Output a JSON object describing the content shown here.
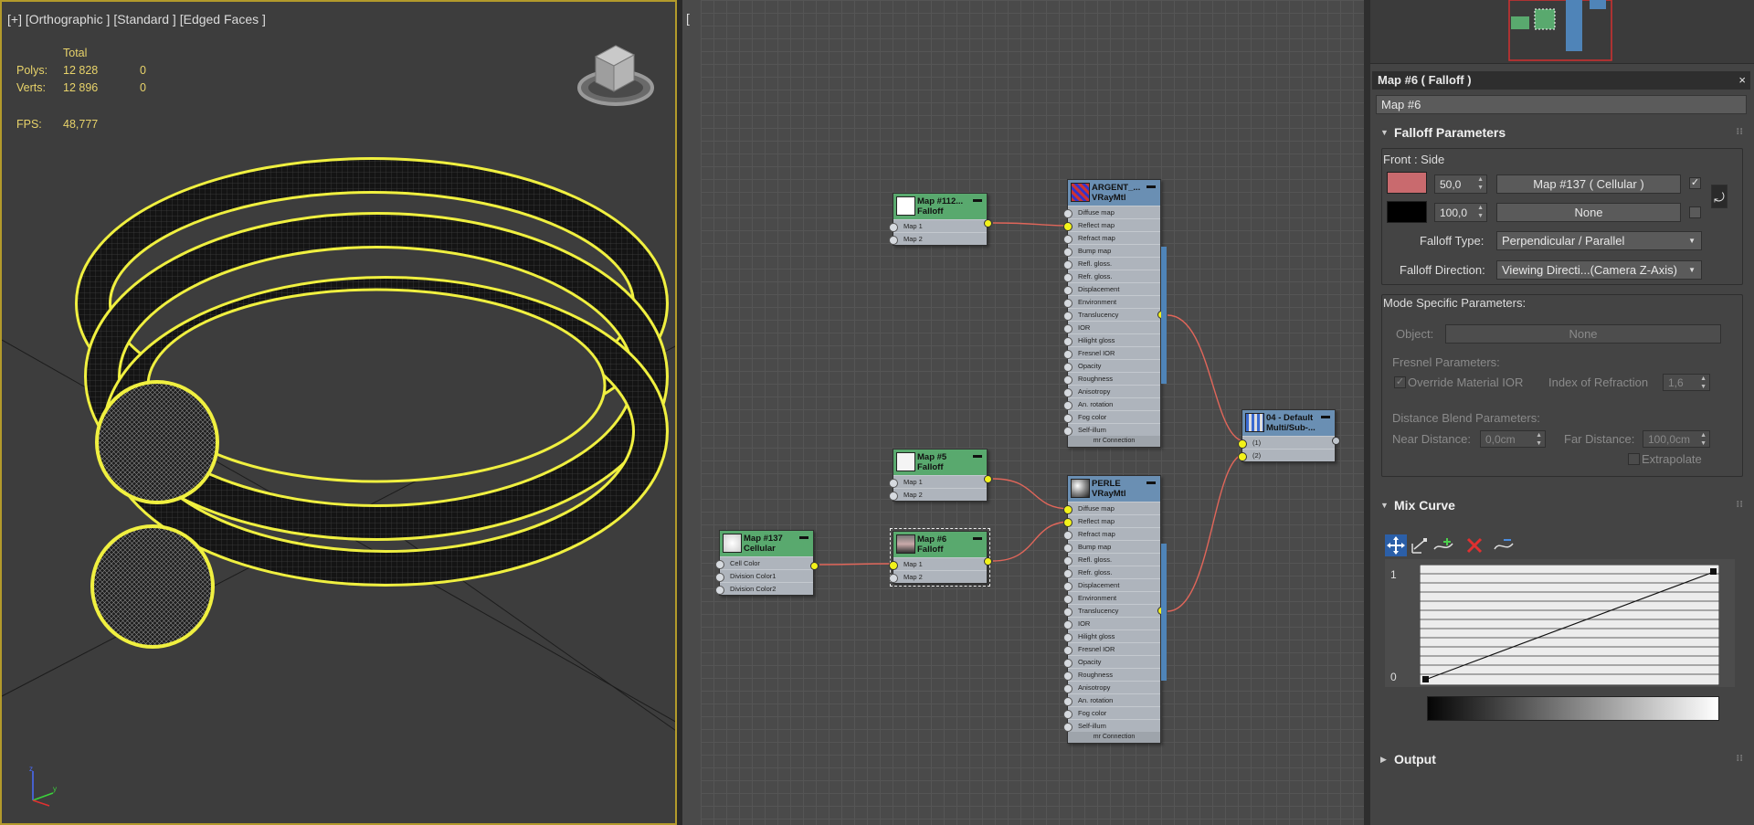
{
  "colors": {
    "accent_yellow": "#e8d36a",
    "selection_outline": "#f2f21a",
    "node_green": "#59a96e",
    "node_blue": "#6a8fb3",
    "wire": "#e0665a",
    "front_swatch": "#c96a6e",
    "side_swatch": "#000000"
  },
  "viewport": {
    "label": "[+] [Orthographic ] [Standard ] [Edged Faces ]",
    "stats": {
      "total_label": "Total",
      "polys_label": "Polys:",
      "polys_total": "12 828",
      "polys_sel": "0",
      "verts_label": "Verts:",
      "verts_total": "12 896",
      "verts_sel": "0",
      "fps_label": "FPS:",
      "fps_value": "48,777"
    },
    "viewcube_icon": "viewcube-icon",
    "axis_icon": "axis-tripod-icon",
    "right_edge_text": "["
  },
  "node_editor": {
    "nodes": {
      "map112": {
        "title1": "Map #112...",
        "title2": "Falloff",
        "slots": [
          "Map 1",
          "Map 2"
        ]
      },
      "map5": {
        "title1": "Map #5",
        "title2": "Falloff",
        "slots": [
          "Map 1",
          "Map 2"
        ]
      },
      "map137": {
        "title1": "Map #137",
        "title2": "Cellular",
        "slots": [
          "Cell Color",
          "Division Color1",
          "Division Color2"
        ]
      },
      "map6": {
        "title1": "Map #6",
        "title2": "Falloff",
        "slots": [
          "Map 1",
          "Map 2"
        ]
      },
      "argent": {
        "title1": "ARGENT_...",
        "title2": "VRayMtl",
        "slots": [
          "Diffuse map",
          "Reflect map",
          "Refract map",
          "Bump map",
          "Refl. gloss.",
          "Refr. gloss.",
          "Displacement",
          "Environment",
          "Translucency",
          "IOR",
          "Hilight gloss",
          "Fresnel IOR",
          "Opacity",
          "Roughness",
          "Anisotropy",
          "An. rotation",
          "Fog color",
          "Self-illum"
        ],
        "footer": "mr Connection"
      },
      "perle": {
        "title1": "PERLE",
        "title2": "VRayMtl",
        "slots": [
          "Diffuse map",
          "Reflect map",
          "Refract map",
          "Bump map",
          "Refl. gloss.",
          "Refr. gloss.",
          "Displacement",
          "Environment",
          "Translucency",
          "IOR",
          "Hilight gloss",
          "Fresnel IOR",
          "Opacity",
          "Roughness",
          "Anisotropy",
          "An. rotation",
          "Fog color",
          "Self-illum"
        ],
        "footer": "mr Connection"
      },
      "multisub": {
        "title1": "04 - Default",
        "title2": "Multi/Sub-...",
        "slots": [
          "(1)",
          "(2)"
        ]
      }
    }
  },
  "panel": {
    "title": "Map #6  ( Falloff )",
    "close": "×",
    "name_value": "Map #6",
    "falloff_params": {
      "header": "Falloff Parameters",
      "front_side_label": "Front : Side",
      "front_amount": "50,0",
      "front_map": "Map #137  ( Cellular )",
      "side_amount": "100,0",
      "side_map": "None",
      "falloff_type_label": "Falloff Type:",
      "falloff_type_value": "Perpendicular / Parallel",
      "falloff_direction_label": "Falloff Direction:",
      "falloff_direction_value": "Viewing Directi...(Camera Z-Axis)"
    },
    "mode_specific": {
      "header": "Mode Specific Parameters:",
      "object_label": "Object:",
      "object_value": "None",
      "fresnel_label": "Fresnel Parameters:",
      "override_ior_label": "Override Material IOR",
      "ior_label": "Index of Refraction",
      "ior_value": "1,6",
      "distance_label": "Distance Blend Parameters:",
      "near_label": "Near Distance:",
      "near_value": "0,0cm",
      "far_label": "Far Distance:",
      "far_value": "100,0cm",
      "extrapolate_label": "Extrapolate"
    },
    "mix_curve": {
      "header": "Mix Curve",
      "y_max": "1",
      "y_min": "0",
      "tools": [
        "move-icon",
        "scale-point-icon",
        "insert-point-icon",
        "delete-point-icon",
        "reset-curve-icon"
      ]
    },
    "output": {
      "header": "Output"
    }
  }
}
